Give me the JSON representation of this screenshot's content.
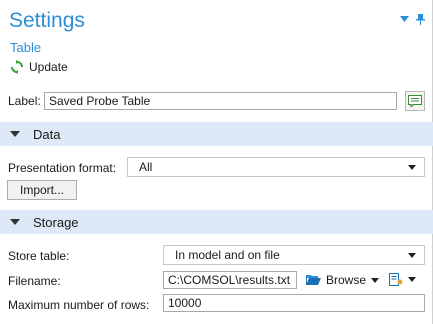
{
  "header": {
    "title": "Settings",
    "subtitle": "Table",
    "update_label": "Update",
    "accent_color": "#2b8fd8"
  },
  "label_field": {
    "label": "Label:",
    "value": "Saved Probe Table"
  },
  "sections": {
    "data": "Data",
    "storage": "Storage"
  },
  "data_section": {
    "presentation_label": "Presentation format:",
    "presentation_value": "All",
    "import_button": "Import..."
  },
  "storage_section": {
    "store_label": "Store table:",
    "store_value": "In model and on file",
    "filename_label": "Filename:",
    "filename_value": "C:\\COMSOL\\results.txt",
    "browse_label": "Browse",
    "max_rows_label": "Maximum number of rows:",
    "max_rows_value": "10000"
  },
  "colors": {
    "section_bg": "#dde9f6",
    "title_color": "#2b8fd8"
  }
}
